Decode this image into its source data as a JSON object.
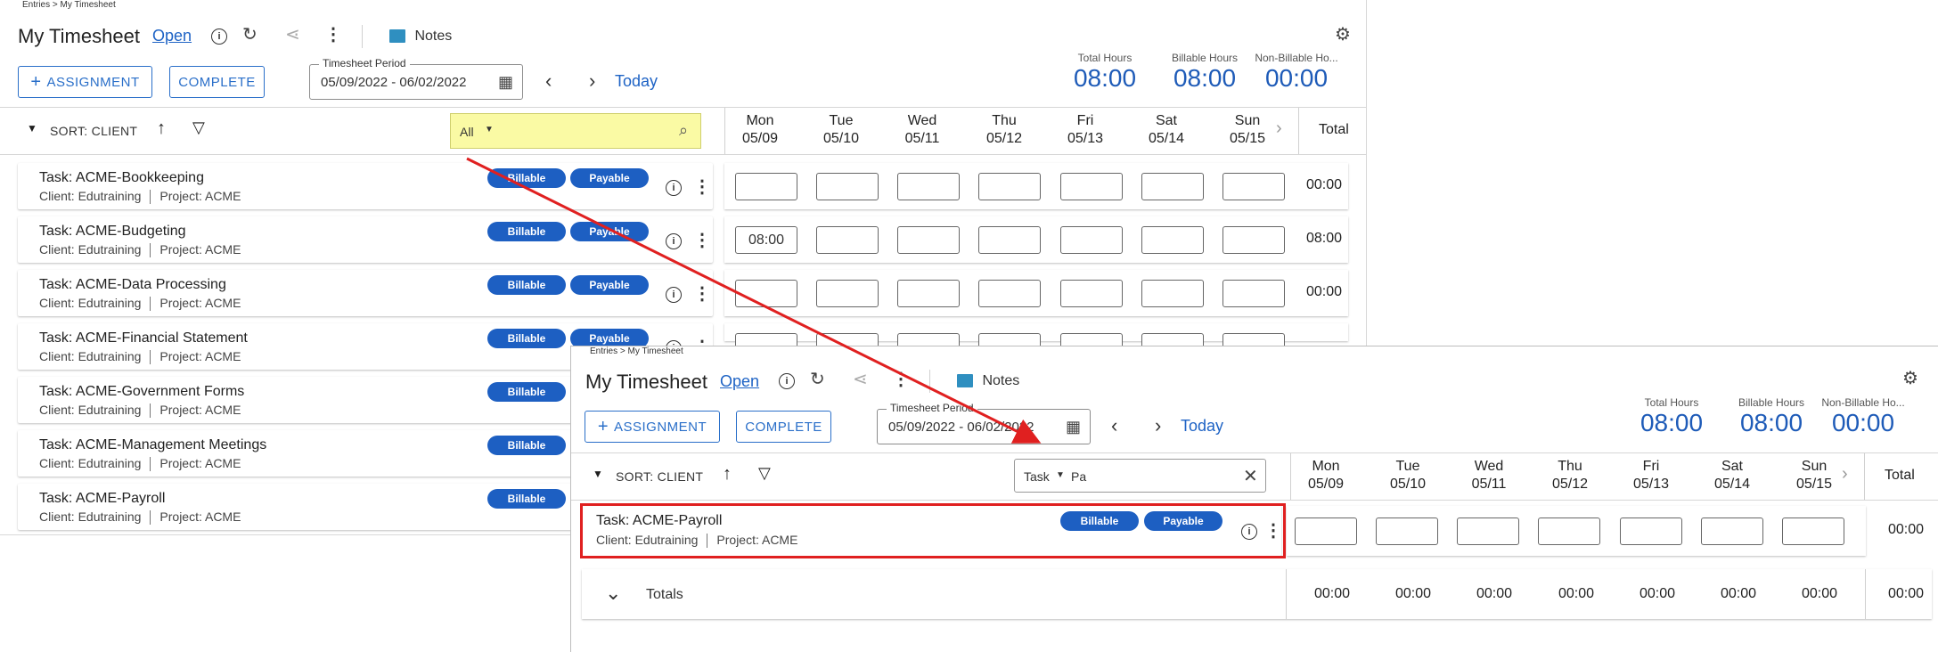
{
  "breadcrumb": "Entries > My Timesheet",
  "title": "My Timesheet",
  "status_link": "Open",
  "notes_label": "Notes",
  "buttons": {
    "assignment": "ASSIGNMENT",
    "complete": "COMPLETE"
  },
  "period": {
    "label": "Timesheet Period",
    "value": "05/09/2022 - 06/02/2022"
  },
  "today_label": "Today",
  "totals_summary": [
    {
      "label": "Total Hours",
      "value": "08:00"
    },
    {
      "label": "Billable Hours",
      "value": "08:00"
    },
    {
      "label": "Non-Billable Ho...",
      "value": "00:00"
    }
  ],
  "sort_label": "SORT: CLIENT",
  "filter_back": {
    "selected": "All"
  },
  "filter_front": {
    "field": "Task",
    "query": "Pa"
  },
  "days": [
    {
      "day": "Mon",
      "date": "05/09"
    },
    {
      "day": "Tue",
      "date": "05/10"
    },
    {
      "day": "Wed",
      "date": "05/11"
    },
    {
      "day": "Thu",
      "date": "05/12"
    },
    {
      "day": "Fri",
      "date": "05/13"
    },
    {
      "day": "Sat",
      "date": "05/14"
    },
    {
      "day": "Sun",
      "date": "05/15"
    }
  ],
  "total_header": "Total",
  "pill_labels": {
    "billable": "Billable",
    "payable": "Payable"
  },
  "tasks": [
    {
      "title": "Task: ACME-Bookkeeping",
      "client": "Client: Edutraining",
      "project": "Project: ACME",
      "mon": "",
      "total": "00:00"
    },
    {
      "title": "Task: ACME-Budgeting",
      "client": "Client: Edutraining",
      "project": "Project: ACME",
      "mon": "08:00",
      "total": "08:00"
    },
    {
      "title": "Task: ACME-Data Processing",
      "client": "Client: Edutraining",
      "project": "Project: ACME",
      "mon": "",
      "total": "00:00"
    },
    {
      "title": "Task: ACME-Financial Statement",
      "client": "Client: Edutraining",
      "project": "Project: ACME"
    },
    {
      "title": "Task: ACME-Government Forms",
      "client": "Client: Edutraining",
      "project": "Project: ACME"
    },
    {
      "title": "Task: ACME-Management Meetings",
      "client": "Client: Edutraining",
      "project": "Project: ACME"
    },
    {
      "title": "Task: ACME-Payroll",
      "client": "Client: Edutraining",
      "project": "Project: ACME"
    }
  ],
  "filtered_task": {
    "title": "Task: ACME-Payroll",
    "client": "Client: Edutraining",
    "project": "Project: ACME",
    "total": "00:00"
  },
  "totals_row": {
    "label": "Totals",
    "days": [
      "00:00",
      "00:00",
      "00:00",
      "00:00",
      "00:00",
      "00:00",
      "00:00"
    ],
    "total": "00:00"
  },
  "annotation_colors": {
    "arrow": "#e02020",
    "highlight": "#e02020"
  },
  "accent": "#1e5bb8"
}
